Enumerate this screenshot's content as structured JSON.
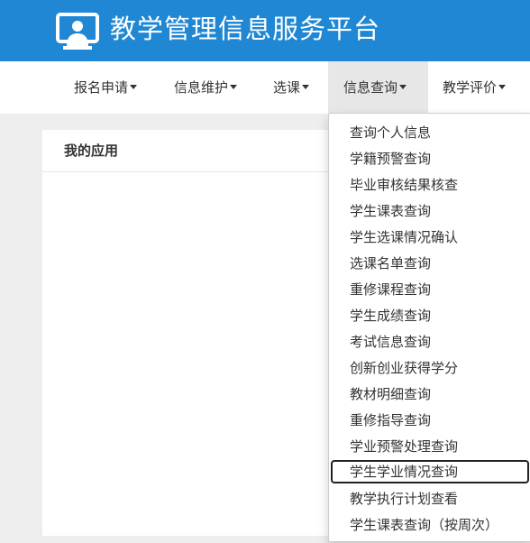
{
  "header": {
    "title": "教学管理信息服务平台",
    "logo_icon": "monitor-user-icon"
  },
  "nav": {
    "items": [
      {
        "label": "报名申请"
      },
      {
        "label": "信息维护"
      },
      {
        "label": "选课"
      },
      {
        "label": "信息查询",
        "active": true
      },
      {
        "label": "教学评价"
      }
    ]
  },
  "panel": {
    "title": "我的应用"
  },
  "dropdown": {
    "items": [
      {
        "label": "查询个人信息"
      },
      {
        "label": "学籍预警查询"
      },
      {
        "label": "毕业审核结果核查"
      },
      {
        "label": "学生课表查询"
      },
      {
        "label": "学生选课情况确认"
      },
      {
        "label": "选课名单查询"
      },
      {
        "label": "重修课程查询"
      },
      {
        "label": "学生成绩查询"
      },
      {
        "label": "考试信息查询"
      },
      {
        "label": "创新创业获得学分"
      },
      {
        "label": "教材明细查询"
      },
      {
        "label": "重修指导查询"
      },
      {
        "label": "学业预警处理查询"
      },
      {
        "label": "学生学业情况查询",
        "focused": true
      },
      {
        "label": "教学执行计划查看"
      },
      {
        "label": "学生课表查询（按周次）"
      }
    ]
  },
  "colors": {
    "header_bg": "#1f87d4",
    "page_bg": "#eeeeee",
    "active_nav_bg": "#e7e7e7"
  }
}
